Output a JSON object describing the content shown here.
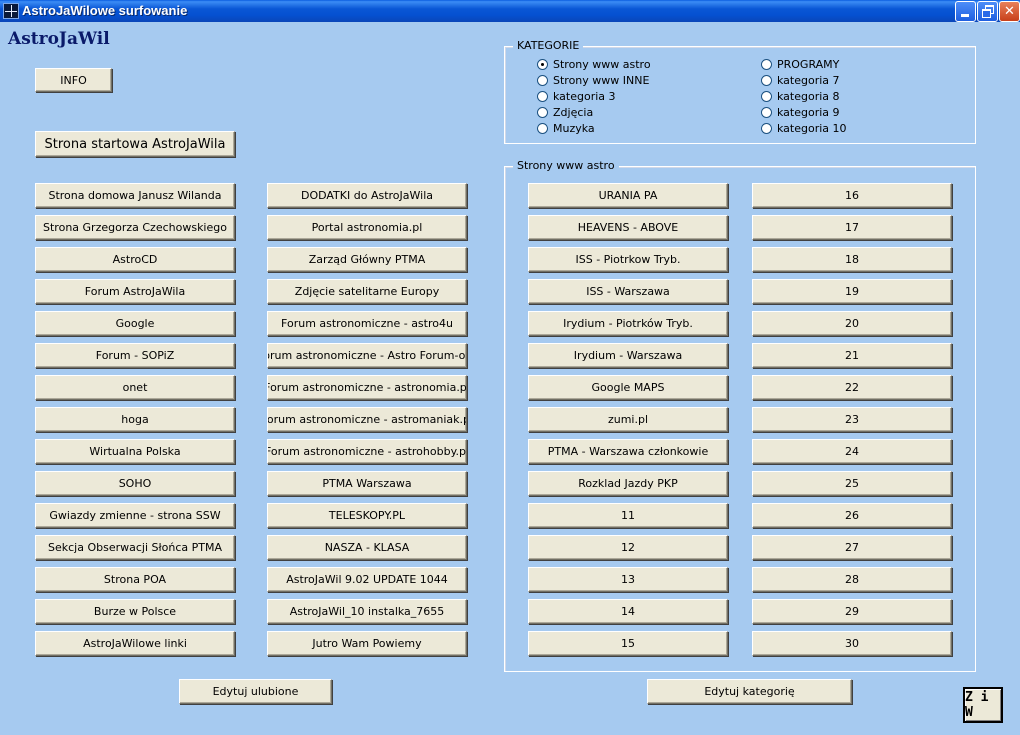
{
  "window": {
    "title": "AstroJaWilowe surfowanie",
    "minimize_icon": "minimize-icon",
    "maximize_icon": "restore-icon",
    "close_symbol": "✕"
  },
  "app": {
    "logo_text": "AstroJaWil",
    "info_label": "INFO",
    "start_page_label": "Strona startowa AstroJaWila",
    "edit_favorites_label": "Edytuj ulubione",
    "edit_category_label": "Edytuj kategorię",
    "ziw_label": "Z i W"
  },
  "favorites_col1": [
    "Strona domowa Janusz Wilanda",
    "Strona Grzegorza Czechowskiego",
    "AstroCD",
    "Forum AstroJaWila",
    "Google",
    "Forum - SOPiZ",
    "onet",
    "hoga",
    "Wirtualna Polska",
    "SOHO",
    "Gwiazdy zmienne - strona SSW",
    "Sekcja Obserwacji Słońca PTMA",
    "Strona POA",
    "Burze w Polsce",
    "AstroJaWilowe linki"
  ],
  "favorites_col2": [
    "DODATKI do AstroJaWila",
    "Portal astronomia.pl",
    "Zarząd Główny PTMA",
    "Zdjęcie satelitarne Europy",
    "Forum astronomiczne - astro4u",
    "Forum astronomiczne - Astro Forum-org",
    "Forum astronomiczne - astronomia.pl",
    "Forum astronomiczne - astromaniak.pl",
    "Forum astronomiczne - astrohobby.pl",
    "PTMA Warszawa",
    "TELESKOPY.PL",
    "NASZA - KLASA",
    "AstroJaWil 9.02 UPDATE 1044",
    "AstroJaWil_10 instalka_7655",
    "Jutro Wam Powiemy"
  ],
  "kategorie": {
    "legend": "KATEGORIE",
    "left": [
      {
        "label": "Strony www astro",
        "checked": true
      },
      {
        "label": "Strony www INNE",
        "checked": false
      },
      {
        "label": "kategoria 3",
        "checked": false
      },
      {
        "label": "Zdjęcia",
        "checked": false
      },
      {
        "label": "Muzyka",
        "checked": false
      }
    ],
    "right": [
      {
        "label": "PROGRAMY",
        "checked": false
      },
      {
        "label": "kategoria 7",
        "checked": false
      },
      {
        "label": "kategoria 8",
        "checked": false
      },
      {
        "label": "kategoria 9",
        "checked": false
      },
      {
        "label": "kategoria 10",
        "checked": false
      }
    ]
  },
  "category_sites": {
    "legend": "Strony www astro",
    "col1": [
      "URANIA PA",
      "HEAVENS - ABOVE",
      "ISS - Piotrkow Tryb.",
      "ISS - Warszawa",
      "Irydium - Piotrków Tryb.",
      "Irydium - Warszawa",
      "Google MAPS",
      "zumi.pl",
      "PTMA - Warszawa członkowie",
      "Rozklad Jazdy PKP",
      "11",
      "12",
      "13",
      "14",
      "15"
    ],
    "col2": [
      "16",
      "17",
      "18",
      "19",
      "20",
      "21",
      "22",
      "23",
      "24",
      "25",
      "26",
      "27",
      "28",
      "29",
      "30"
    ]
  }
}
